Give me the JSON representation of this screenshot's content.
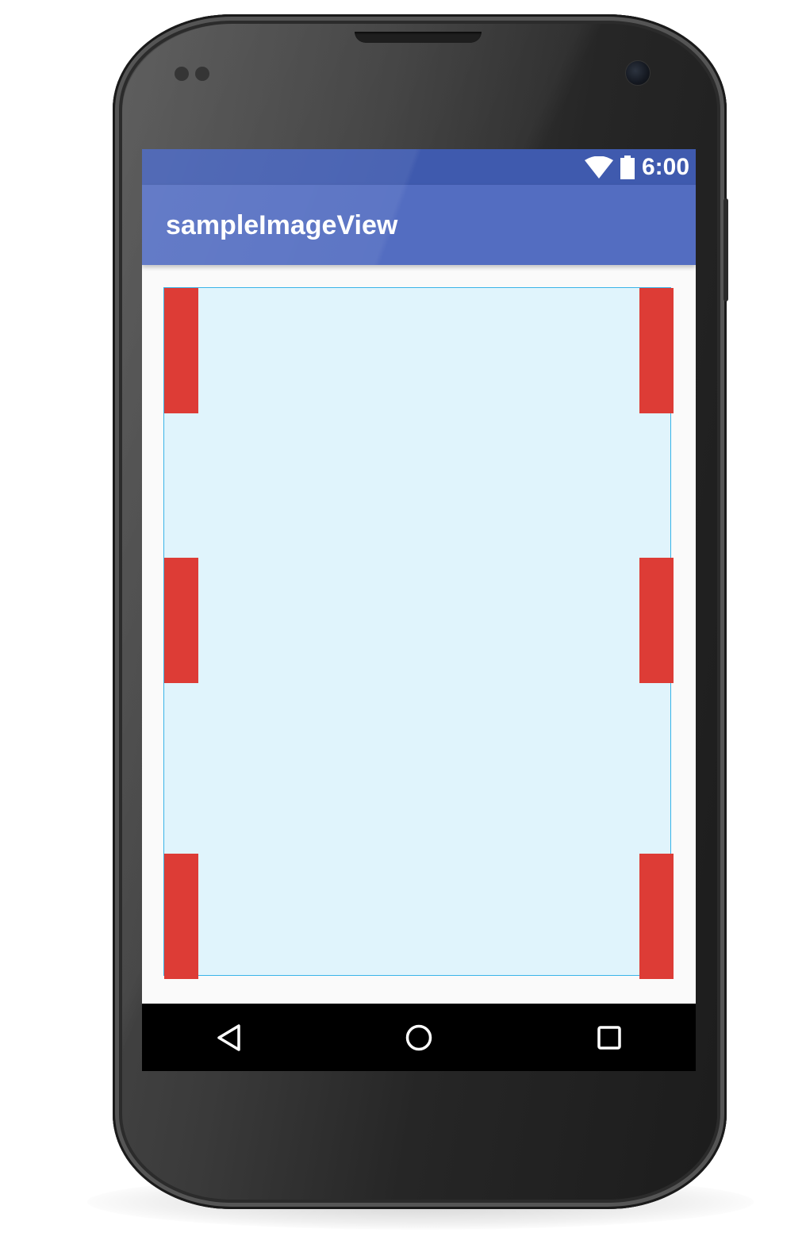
{
  "status_bar": {
    "time": "6:00",
    "icons": [
      "wifi-icon",
      "battery-icon"
    ]
  },
  "app_bar": {
    "title": "sampleImageView"
  },
  "image_view": {
    "image": "red-bars-placeholder"
  },
  "navigation_bar": {
    "buttons": [
      "back-icon",
      "home-icon",
      "recents-icon"
    ]
  },
  "colors": {
    "status_bar": "#3f5aae",
    "app_bar": "#536dc1",
    "image_background": "#e0f4fc",
    "image_border": "#3ab4e8",
    "red_bar": "#dd3c36",
    "navigation_bar": "#000000"
  }
}
